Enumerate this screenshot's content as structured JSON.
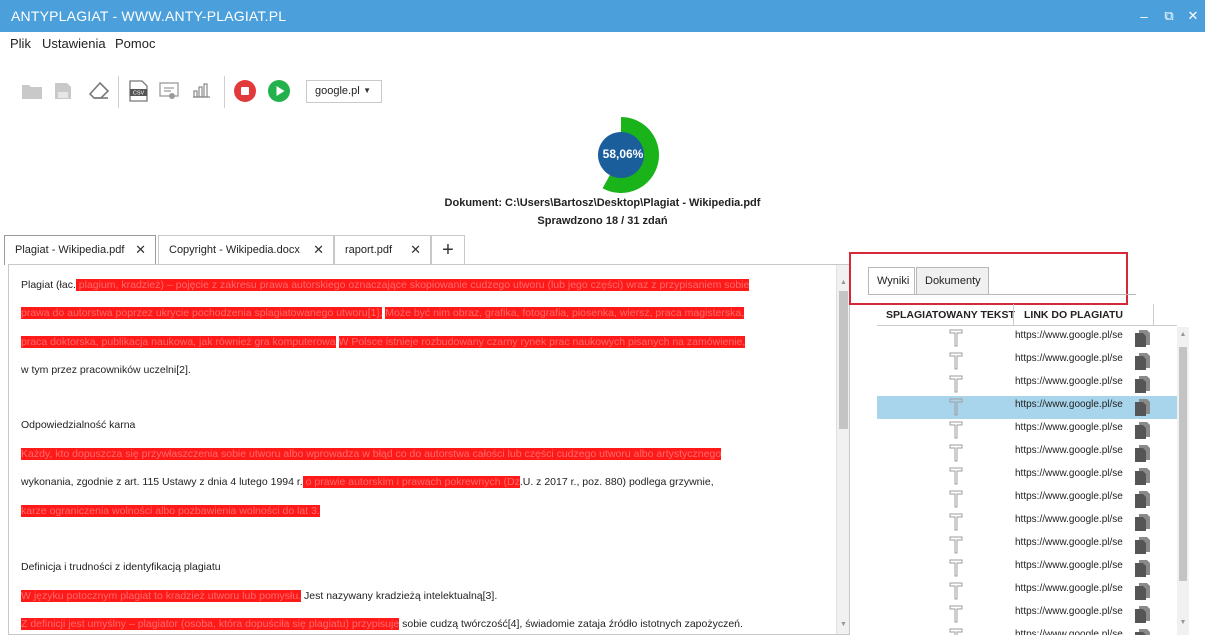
{
  "window": {
    "title": "ANTYPLAGIAT - WWW.ANTY-PLAGIAT.PL",
    "controls": {
      "minimize": "–",
      "restore": "⧉",
      "close": "✕"
    }
  },
  "menu": [
    "Plik",
    "Ustawienia",
    "Pomoc"
  ],
  "toolbar": {
    "buttons": [
      "open-folder-icon",
      "save-icon",
      "eraser-icon",
      "csv-export-icon",
      "preview-icon",
      "chart-icon",
      "stop-icon",
      "play-icon"
    ],
    "csv_label": "CSV",
    "engine": {
      "selected": "google.pl",
      "caret": "▼"
    }
  },
  "summary": {
    "percent": "58,06%",
    "percent_value": 58.06,
    "document": "Dokument: C:\\Users\\Bartosz\\Desktop\\Plagiat - Wikipedia.pdf",
    "checked": "Sprawdzono 18 / 31 zdań",
    "colors": {
      "plagiarized": "#1ab31a",
      "center": "#1a5e9c"
    }
  },
  "doc_tabs": [
    {
      "label": "Plagiat - Wikipedia.pdf",
      "close": "✕"
    },
    {
      "label": "Copyright - Wikipedia.docx",
      "close": "✕"
    },
    {
      "label": "raport.pdf",
      "close": "✕"
    }
  ],
  "add_tab": "+",
  "document_lines": [
    [
      {
        "t": "Plagiat (łac.",
        "h": false
      },
      {
        "t": " plagium, kradzież) – pojęcie z zakresu prawa autorskiego oznaczające skopiowanie cudzego utworu (lub jego części) wraz z przypisaniem sobie",
        "h": true
      }
    ],
    [
      {
        "t": "prawa do autorstwa poprzez ukrycie pochodzenia splagiatowanego utworu[1].",
        "h": true
      },
      {
        "t": " ",
        "h": false
      },
      {
        "t": "Może być nim obraz, grafika, fotografia, piosenka, wiersz, praca magisterska,",
        "h": true
      }
    ],
    [
      {
        "t": "praca doktorska, publikacja naukowa, jak również gra komputerowa",
        "h": true
      },
      {
        "t": " ",
        "h": false
      },
      {
        "t": "W Polsce istnieje rozbudowany czarny rynek prac naukowych pisanych na zamówienie,",
        "h": true
      }
    ],
    [
      {
        "t": "w tym przez pracowników uczelni[2].",
        "h": false
      }
    ],
    [],
    [
      {
        "t": "Odpowiedzialność karna",
        "h": false
      }
    ],
    [
      {
        "t": "Każdy, kto dopuszcza się przywłaszczenia sobie utworu albo wprowadza w błąd co do autorstwa całości lub części cudzego utworu albo artystycznego",
        "h": true
      }
    ],
    [
      {
        "t": "wykonania, zgodnie z art. 115 Ustawy z dnia 4 lutego 1994 r.",
        "h": false
      },
      {
        "t": " o prawie autorskim i prawach pokrewnych (Dz",
        "h": true
      },
      {
        "t": ".U. z 2017 r., poz. 880) podlega grzywnie,",
        "h": false
      }
    ],
    [
      {
        "t": "karze ograniczenia wolności albo pozbawienia wolności do lat 3.",
        "h": true
      }
    ],
    [],
    [
      {
        "t": "Definicja i trudności z identyfikacją plagiatu",
        "h": false
      }
    ],
    [
      {
        "t": "W języku potocznym plagiat to kradzież utworu lub pomysłu.",
        "h": true
      },
      {
        "t": " Jest nazywany kradzieżą intelektualną[3].",
        "h": false
      }
    ],
    [
      {
        "t": "Z definicji jest umyślny – plagiator (osoba, która dopuściła się plagiatu) przypisuje",
        "h": true
      },
      {
        "t": " sobie cudzą twórczość[4], świadomie zataja źródło istotnych zapożyczeń.",
        "h": false
      }
    ]
  ],
  "results": {
    "tabs": [
      "Wyniki",
      "Dokumenty"
    ],
    "headers": [
      "SPLAGIATOWANY TEKST",
      "LINK DO PLAGIATU"
    ],
    "rows": [
      "https://www.google.pl/search",
      "https://www.google.pl/search",
      "https://www.google.pl/search",
      "https://www.google.pl/search",
      "https://www.google.pl/search",
      "https://www.google.pl/search",
      "https://www.google.pl/search",
      "https://www.google.pl/search",
      "https://www.google.pl/search",
      "https://www.google.pl/search",
      "https://www.google.pl/search",
      "https://www.google.pl/search",
      "https://www.google.pl/search",
      "https://www.google.pl/search"
    ],
    "selected_row": 3
  }
}
